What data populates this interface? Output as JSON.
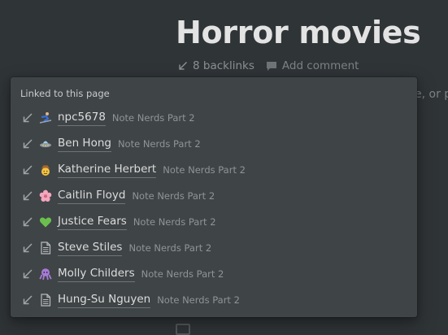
{
  "page": {
    "title": "Horror movies",
    "backlinks_label": "8 backlinks",
    "add_comment_label": "Add comment",
    "background_snippet": "e, or p"
  },
  "popup": {
    "header": "Linked to this page",
    "items": [
      {
        "name": "npc5678",
        "workspace": "Note Nerds Part 2",
        "icon": "skier-icon"
      },
      {
        "name": "Ben Hong",
        "workspace": "Note Nerds Part 2",
        "icon": "ufo-icon"
      },
      {
        "name": "Katherine Herbert",
        "workspace": "Note Nerds Part 2",
        "icon": "cowboy-face-icon"
      },
      {
        "name": "Caitlin Floyd",
        "workspace": "Note Nerds Part 2",
        "icon": "cherry-blossom-icon"
      },
      {
        "name": "Justice Fears",
        "workspace": "Note Nerds Part 2",
        "icon": "green-heart-icon"
      },
      {
        "name": "Steve Stiles",
        "workspace": "Note Nerds Part 2",
        "icon": "document-icon"
      },
      {
        "name": "Molly Childers",
        "workspace": "Note Nerds Part 2",
        "icon": "octopus-icon"
      },
      {
        "name": "Hung-Su Nguyen",
        "workspace": "Note Nerds Part 2",
        "icon": "document-icon"
      }
    ]
  },
  "colors": {
    "background": "#2f3437",
    "popup": "#3f4447",
    "title_text": "#e3e3e3",
    "muted_text": "#8c9193"
  }
}
